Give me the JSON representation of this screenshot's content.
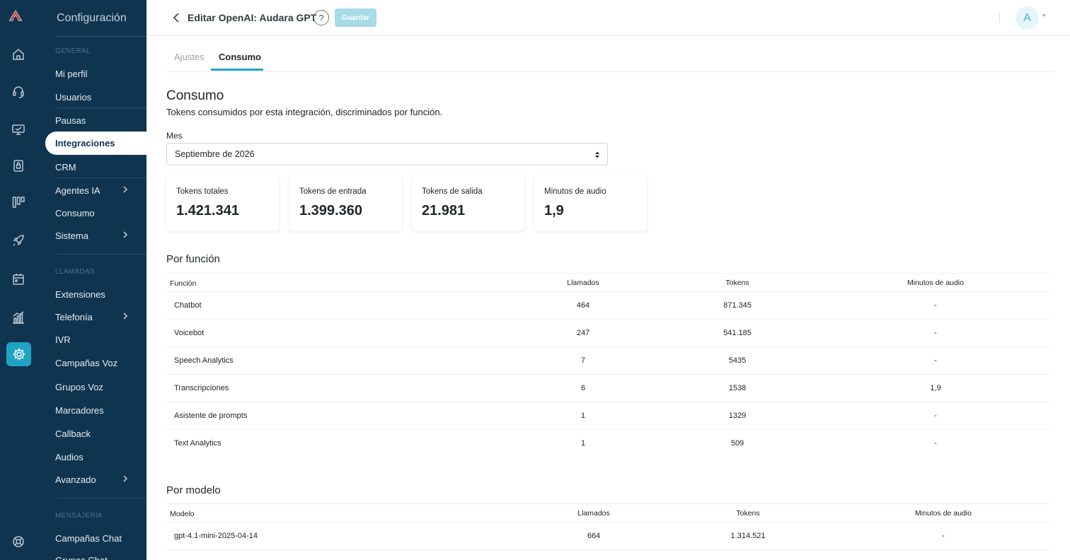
{
  "sidebar": {
    "title": "Configuración",
    "sections": {
      "general": "GENERAL",
      "llamadas": "LLAMADAS",
      "mensajeria": "MENSAJERÍA"
    },
    "items": [
      "Mi perfil",
      "Usuarios",
      "Pausas",
      "Integraciones",
      "CRM",
      "Agentes IA",
      "Consumo",
      "Sistema",
      "Extensiones",
      "Telefonía",
      "IVR",
      "Campañas Voz",
      "Grupos Voz",
      "Marcadores",
      "Callback",
      "Audios",
      "Avanzado",
      "Campañas Chat",
      "Grupos Chat"
    ],
    "active_item": "Integraciones"
  },
  "header": {
    "title": "Editar OpenAI: Audara GPT",
    "help": "?",
    "save_label": "Guardar",
    "avatar_letter": "A"
  },
  "tabs": [
    "Ajustes",
    "Consumo"
  ],
  "active_tab": "Consumo",
  "consumo": {
    "title": "Consumo",
    "subtitle": "Tokens consumidos por esta integración, discriminados por función.",
    "month_label": "Mes",
    "month_value": "Septiembre de 2026"
  },
  "stats": [
    {
      "label": "Tokens totales",
      "value": "1.421.341"
    },
    {
      "label": "Tokens de entrada",
      "value": "1.399.360"
    },
    {
      "label": "Tokens de salida",
      "value": "21.981"
    },
    {
      "label": "Minutos de audio",
      "value": "1,9"
    }
  ],
  "por_funcion": {
    "title": "Por función",
    "headers": [
      "Función",
      "Llamados",
      "Tokens",
      "Minutos de audio"
    ],
    "rows": [
      [
        "Chatbot",
        "464",
        "871.345",
        "-"
      ],
      [
        "Voicebot",
        "247",
        "541.185",
        "-"
      ],
      [
        "Speech Analytics",
        "7",
        "5435",
        "-"
      ],
      [
        "Transcripciones",
        "6",
        "1538",
        "1,9"
      ],
      [
        "Asistente de prompts",
        "1",
        "1329",
        "-"
      ],
      [
        "Text Analytics",
        "1",
        "509",
        "-"
      ]
    ]
  },
  "por_modelo": {
    "title": "Por modelo",
    "headers": [
      "Modelo",
      "Llamados",
      "Tokens",
      "Minutos de audio"
    ],
    "rows": [
      [
        "gpt-4.1-mini-2025-04-14",
        "664",
        "1.314.521",
        "-"
      ]
    ]
  },
  "colors": {
    "sidebar": "#0f3450",
    "accent": "#1fa3c4",
    "save_disabled": "#a6dbe8"
  },
  "icons": [
    "logo-icon",
    "home-icon",
    "headset-icon",
    "monitor-icon",
    "lock-icon",
    "columns-icon",
    "rocket-icon",
    "calendar-icon",
    "bar-chart-icon",
    "gear-icon",
    "lifebuoy-icon",
    "chevron-left-icon",
    "chevron-right-icon",
    "select-arrows-icon"
  ]
}
